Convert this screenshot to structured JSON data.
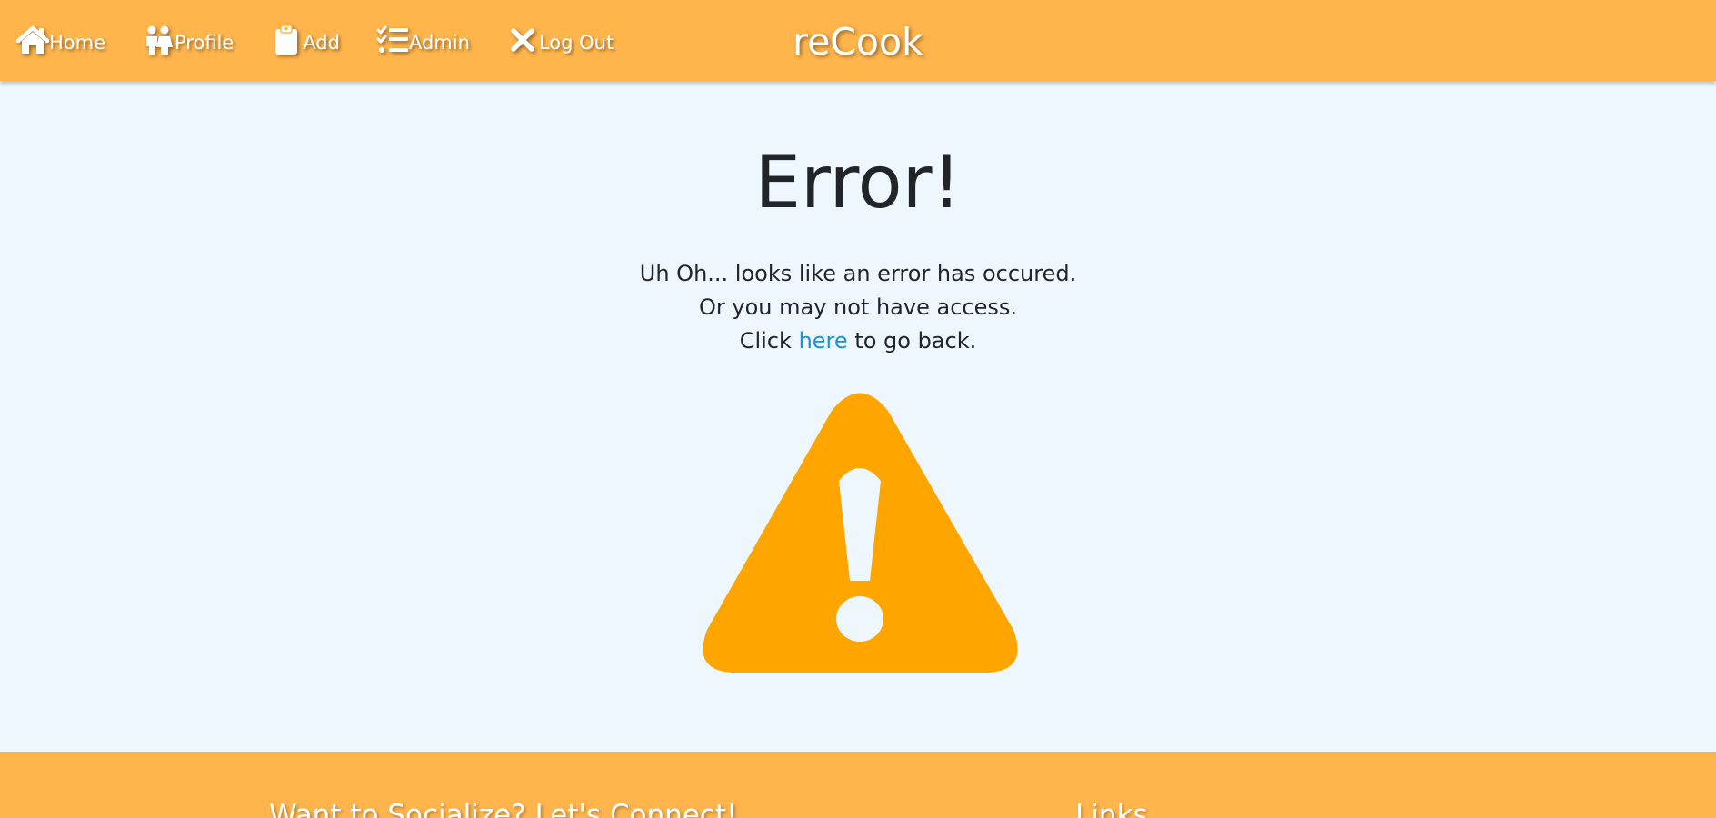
{
  "navbar": {
    "brand": "reCook",
    "items": [
      {
        "label": "Home",
        "icon": "home-icon"
      },
      {
        "label": "Profile",
        "icon": "users-icon"
      },
      {
        "label": "Add",
        "icon": "clipboard-icon"
      },
      {
        "label": "Admin",
        "icon": "tasks-icon"
      },
      {
        "label": "Log Out",
        "icon": "close-icon"
      }
    ]
  },
  "main": {
    "title": "Error!",
    "line1": "Uh Oh... looks like an error has occured.",
    "line2": "Or you may not have access.",
    "line3_prefix": "Click ",
    "line3_link": "here",
    "line3_suffix": " to go back.",
    "warning_icon": "warning-icon"
  },
  "footer": {
    "social_heading": "Want to Socialize? Let's Connect!",
    "links_heading": "Links"
  },
  "colors": {
    "header_bg": "#ffb54c",
    "page_bg": "#eef7fd",
    "warning": "#ffa500",
    "link": "#1e90d6",
    "text": "#212529"
  }
}
